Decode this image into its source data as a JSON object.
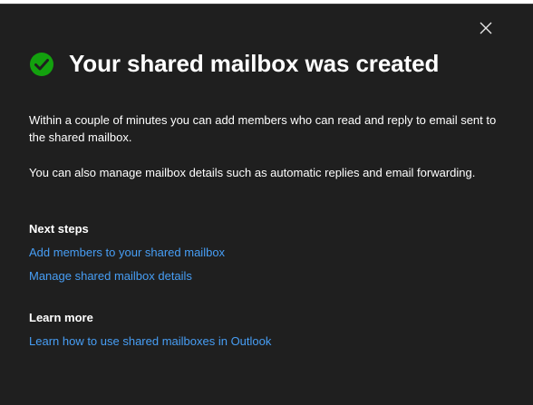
{
  "dialog": {
    "title": "Your shared mailbox was created",
    "description_1": "Within a couple of minutes you can add members who can read and reply to email sent to the shared mailbox.",
    "description_2": "You can also manage mailbox details such as automatic replies and email forwarding."
  },
  "next_steps": {
    "heading": "Next steps",
    "links": [
      "Add members to your shared mailbox",
      "Manage shared mailbox details"
    ]
  },
  "learn_more": {
    "heading": "Learn more",
    "links": [
      "Learn how to use shared mailboxes in Outlook"
    ]
  },
  "icons": {
    "success": "check-circle-icon",
    "close": "close-icon"
  },
  "colors": {
    "background": "#1f1f1f",
    "success": "#13a10e",
    "link": "#479ef5",
    "text": "#ffffff"
  }
}
